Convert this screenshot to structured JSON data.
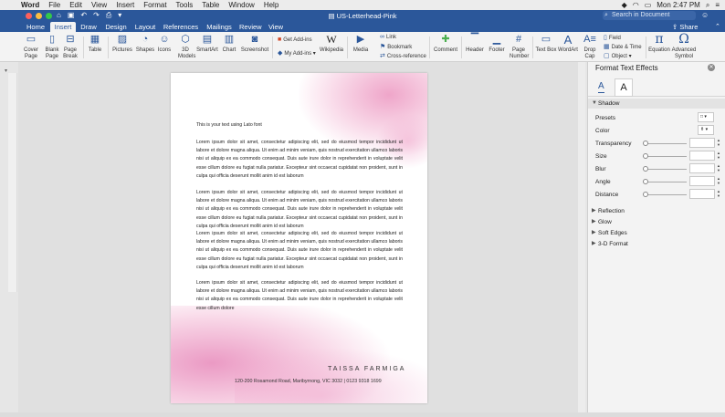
{
  "menubar": {
    "app": "Word",
    "items": [
      "File",
      "Edit",
      "View",
      "Insert",
      "Format",
      "Tools",
      "Table",
      "Window",
      "Help"
    ],
    "clock": "Mon 2:47 PM"
  },
  "titlebar": {
    "doc_title": "US-Letterhead-Pink",
    "search_placeholder": "Search in Document"
  },
  "tabs": [
    "Home",
    "Insert",
    "Draw",
    "Design",
    "Layout",
    "References",
    "Mailings",
    "Review",
    "View"
  ],
  "active_tab": "Insert",
  "share": "Share",
  "ribbon": {
    "cover_page": "Cover Page",
    "blank_page": "Blank Page",
    "page_break": "Page Break",
    "table": "Table",
    "pictures": "Pictures",
    "shapes": "Shapes",
    "icons": "Icons",
    "models3d": "3D Models",
    "smartart": "SmartArt",
    "chart": "Chart",
    "screenshot": "Screenshot",
    "get_addins": "Get Add-ins",
    "my_addins": "My Add-ins",
    "wikipedia": "Wikipedia",
    "media": "Media",
    "link": "Link",
    "bookmark": "Bookmark",
    "cross_reference": "Cross-reference",
    "comment": "Comment",
    "header": "Header",
    "footer": "Footer",
    "page_number": "Page Number",
    "text_box": "Text Box",
    "wordart": "WordArt",
    "drop_cap": "Drop Cap",
    "field": "Field",
    "date_time": "Date & Time",
    "object": "Object",
    "equation": "Equation",
    "advanced_symbol": "Advanced Symbol"
  },
  "document": {
    "intro": "This is your text using Lato font",
    "para1": "Lorem ipsum dolor sit amet, consectetur adipiscing elit, sed do eiusmod tempor incididunt ut labore et dolore magna aliqua. Ut enim ad minim veniam, quis nostrud exercitation ullamco laboris nisi ut aliquip ex ea commodo consequat. Duis aute irure dolor in reprehenderit in voluptate velit esse cillum dolore eu fugiat nulla pariatur. Excepteur sint occaecat cupidatat non proident, sunt in culpa qui officia deserunt mollit anim id est laborum",
    "para2": "Lorem ipsum dolor sit amet, consectetur adipiscing elit, sed do eiusmod tempor incididunt ut labore et dolore magna aliqua. Ut enim ad minim veniam, quis nostrud exercitation ullamco laboris nisi ut aliquip ex ea commodo consequat. Duis aute irure dolor in reprehenderit in voluptate velit esse cillum dolore eu fugiat nulla pariatur. Excepteur sint occaecat cupidatat non proident, sunt in culpa qui officia deserunt mollit anim id est laborum",
    "para3": "Lorem ipsum dolor sit amet, consectetur adipiscing elit, sed do eiusmod tempor incididunt ut labore et dolore magna aliqua. Ut enim ad minim veniam, quis nostrud exercitation ullamco laboris nisi ut aliquip ex ea commodo consequat. Duis aute irure dolor in reprehenderit in voluptate velit esse cillum dolore eu fugiat nulla pariatur. Excepteur sint occaecat cupidatat non proident, sunt in culpa qui officia deserunt mollit anim id est laborum",
    "para4": "Lorem ipsum dolor sit amet, consectetur adipiscing elit, sed do eiusmod tempor incididunt ut labore et dolore magna aliqua. Ut enim ad minim veniam, quis nostrud exercitation ullamco laboris nisi ut aliquip ex ea commodo consequat. Duis aute irure dolor in reprehenderit in voluptate velit esse cillum dolore",
    "name": "TAISSA FARMIGA",
    "address": "120-200 Rosamond Road, Maribyrnong, VIC 3032  |  0123 9318 1699"
  },
  "pane": {
    "title": "Format Text Effects",
    "shadow": "Shadow",
    "presets": "Presets",
    "color": "Color",
    "transparency": "Transparency",
    "size": "Size",
    "blur": "Blur",
    "angle": "Angle",
    "distance": "Distance",
    "reflection": "Reflection",
    "glow": "Glow",
    "soft_edges": "Soft Edges",
    "format3d": "3-D Format"
  },
  "colors": {
    "word_blue": "#2b579a",
    "pink": "#e67fb6"
  }
}
